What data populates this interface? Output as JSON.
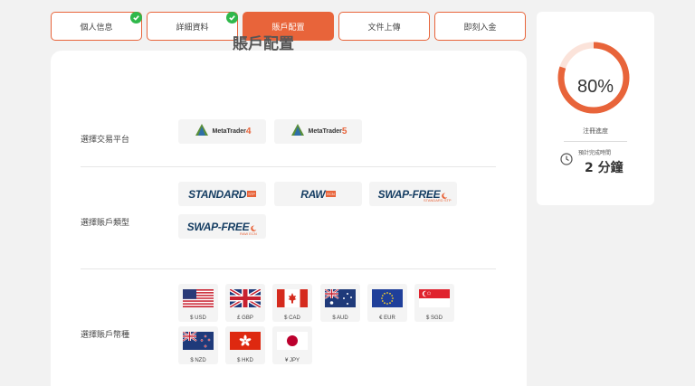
{
  "steps": [
    {
      "label": "個人信息",
      "done": true
    },
    {
      "label": "詳細資料",
      "done": true
    },
    {
      "label": "賬戶配置",
      "active": true
    },
    {
      "label": "文件上傳"
    },
    {
      "label": "即刻入金"
    }
  ],
  "form": {
    "title": "賬戶配置",
    "platform": {
      "label": "選擇交易平台",
      "options": [
        {
          "name": "MetaTrader",
          "version": "4"
        },
        {
          "name": "MetaTrader",
          "version": "5"
        }
      ]
    },
    "account_type": {
      "label": "選擇賬戶類型",
      "options": [
        {
          "name": "STANDARD",
          "tag": "STP"
        },
        {
          "name": "RAW",
          "tag": "ECN"
        },
        {
          "name": "SWAP-FREE",
          "tag": "STANDARD STP"
        },
        {
          "name": "SWAP-FREE",
          "tag": "RAW ECN"
        }
      ]
    },
    "currency": {
      "label": "選擇賬戶幣種",
      "options": [
        {
          "code": "$ USD",
          "flag": "us-flag-icon"
        },
        {
          "code": "£ GBP",
          "flag": "uk-flag-icon"
        },
        {
          "code": "$ CAD",
          "flag": "ca-flag-icon"
        },
        {
          "code": "$ AUD",
          "flag": "au-flag-icon"
        },
        {
          "code": "€ EUR",
          "flag": "eu-flag-icon"
        },
        {
          "code": "$ SGD",
          "flag": "sg-flag-icon"
        },
        {
          "code": "$ NZD",
          "flag": "nz-flag-icon"
        },
        {
          "code": "$ HKD",
          "flag": "hk-flag-icon"
        },
        {
          "code": "¥ JPY",
          "flag": "jp-flag-icon"
        }
      ]
    }
  },
  "progress": {
    "value": "80%",
    "fraction": 0.8,
    "label": "注冊進度",
    "estimate_label": "預計完成時間",
    "estimate_value": "2 分鐘"
  },
  "colors": {
    "accent": "#e8643a",
    "check": "#2fb84b",
    "brand_text": "#163e63"
  }
}
